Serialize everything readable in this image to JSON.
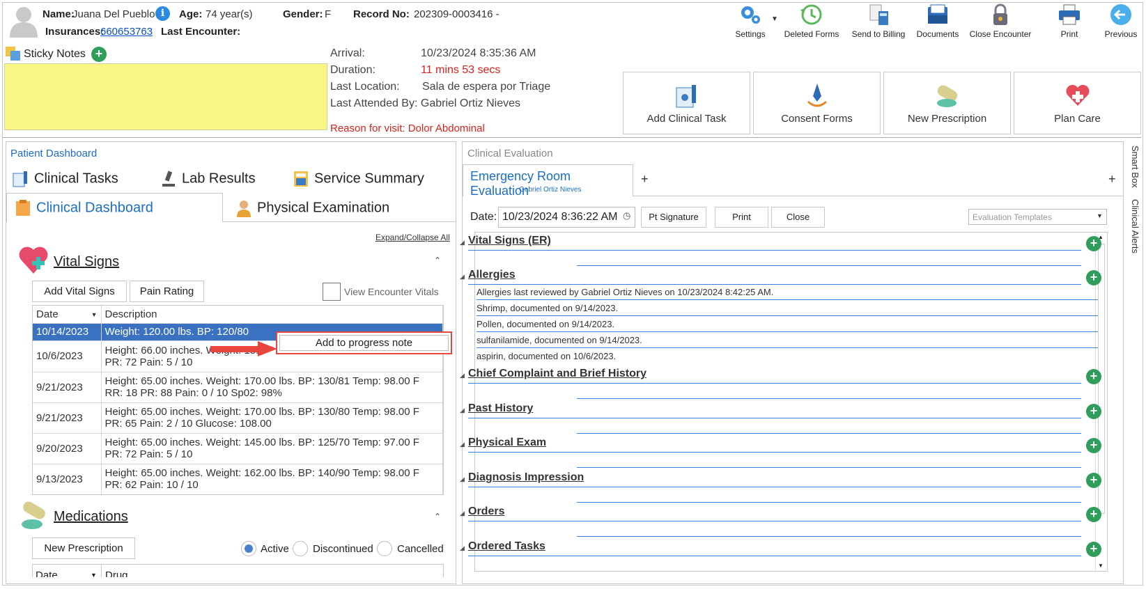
{
  "patient": {
    "name_label": "Name:",
    "name": "Juana Del Pueblo",
    "age_label": "Age:",
    "age": "74 year(s)",
    "gender_label": "Gender:",
    "gender": "F",
    "record_label": "Record No:",
    "record": "202309-0003416 -",
    "insurances_label": "Insurances:",
    "insurance": "660653763",
    "last_encounter_label": "Last Encounter:"
  },
  "toolbar": [
    {
      "label": "Settings",
      "icon": "gear-icon"
    },
    {
      "label": "Deleted Forms",
      "icon": "restore-icon"
    },
    {
      "label": "Send to Billing",
      "icon": "billing-icon"
    },
    {
      "label": "Documents",
      "icon": "documents-icon"
    },
    {
      "label": "Close Encounter",
      "icon": "lock-icon"
    },
    {
      "label": "Print",
      "icon": "printer-icon"
    },
    {
      "label": "Previous",
      "icon": "arrow-left-icon"
    }
  ],
  "sticky": {
    "label": "Sticky Notes"
  },
  "encounter": {
    "arrival_label": "Arrival:",
    "arrival": "10/23/2024 8:35:36 AM",
    "duration_label": "Duration:",
    "duration": "11 mins 53 secs",
    "location_label": "Last Location:",
    "location": "Sala de espera por Triage",
    "attended_label": "Last Attended By: Gabriel Ortiz Nieves",
    "reason": "Reason for visit: Dolor Abdominal"
  },
  "actions": [
    "Add Clinical Task",
    "Consent Forms",
    "New Prescription",
    "Plan Care"
  ],
  "dashboard": {
    "title": "Patient Dashboard",
    "tabs_row1": [
      "Clinical Tasks",
      "Lab Results",
      "Service Summary"
    ],
    "tabs_row2": [
      "Clinical Dashboard",
      "Physical Examination"
    ],
    "expand": "Expand/Collapse All",
    "vitals_title": "Vital Signs",
    "add_vitals": "Add Vital Signs",
    "pain_rating": "Pain Rating",
    "view_encounter_vitals": "View Encounter Vitals",
    "col_date": "Date",
    "col_desc": "Description",
    "rows": [
      {
        "date": "10/14/2023",
        "desc": "Weight: 120.00 lbs. BP: 120/80",
        "desc2": ""
      },
      {
        "date": "10/6/2023",
        "desc": "Height: 66.00 inches. Weight: 18...",
        "desc2": "PR: 72 Pain: 5 / 10"
      },
      {
        "date": "9/21/2023",
        "desc": "Height: 65.00 inches. Weight: 170.00 lbs. BP: 130/81 Temp: 98.00 F",
        "desc2": "RR: 18 PR: 88 Pain: 0 / 10 Sp02: 98%"
      },
      {
        "date": "9/21/2023",
        "desc": "Height: 65.00 inches. Weight: 170.00 lbs. BP: 130/80 Temp: 98.00 F",
        "desc2": "PR: 65 Pain: 2 / 10 Glucose: 108.00"
      },
      {
        "date": "9/20/2023",
        "desc": "Height: 65.00 inches. Weight: 145.00 lbs. BP: 125/70 Temp: 97.00 F",
        "desc2": "PR: 72 Pain: 5 / 10"
      },
      {
        "date": "9/13/2023",
        "desc": "Height: 65.00 inches. Weight: 162.00 lbs. BP: 140/90 Temp: 98.00 F",
        "desc2": "PR: 62 Pain: 10 / 10"
      }
    ],
    "context_menu": "Add to progress note",
    "meds_title": "Medications",
    "new_prescription": "New Prescription",
    "radio_active": "Active",
    "radio_discontinued": "Discontinued",
    "radio_cancelled": "Cancelled",
    "meds_col_date": "Date",
    "meds_col_drug": "Drug"
  },
  "evaluation": {
    "panel_title": "Clinical Evaluation",
    "tab_title": "Emergency Room Evaluation",
    "tab_sub": "Gabriel Ortiz Nieves",
    "date_label": "Date:",
    "date_value": "10/23/2024 8:36:22 AM",
    "pt_signature": "Pt Signature",
    "print": "Print",
    "close": "Close",
    "templates_placeholder": "Evaluation Templates",
    "sections": [
      "Vital Signs (ER)",
      "Allergies",
      "Chief Complaint and Brief History",
      "Past History",
      "Physical Exam",
      "Diagnosis Impression",
      "Orders",
      "Ordered Tasks"
    ],
    "allergies": [
      "Allergies last reviewed by Gabriel Ortiz Nieves on 10/23/2024 8:42:25 AM.",
      "Shrimp, documented on 9/14/2023.",
      "Pollen, documented on 9/14/2023.",
      "sulfanilamide, documented on 9/14/2023.",
      "aspirin, documented on 10/6/2023."
    ]
  },
  "side_tabs": [
    "Smart Box",
    "Clinical Alerts"
  ]
}
